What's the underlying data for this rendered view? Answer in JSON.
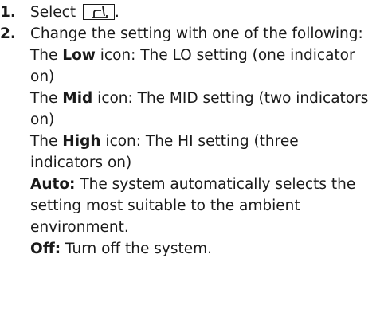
{
  "steps": [
    {
      "number": "1.",
      "text_before": "Select ",
      "icon": "seat-heater-icon",
      "text_after": "."
    },
    {
      "number": "2.",
      "intro": "Change the setting with one of the following:",
      "options": [
        {
          "prefix": "The ",
          "bold": "Low",
          "rest": " icon: The LO setting (one indicator on)"
        },
        {
          "prefix": "The ",
          "bold": "Mid",
          "rest": " icon: The MID setting (two indicators on)"
        },
        {
          "prefix": "The ",
          "bold": "High",
          "rest": " icon: The HI setting (three indicators on)"
        },
        {
          "prefix": "",
          "bold": "Auto:",
          "rest": " The system automatically selects the setting most suitable to the ambient environment."
        },
        {
          "prefix": "",
          "bold": "Off:",
          "rest": " Turn off the system."
        }
      ]
    }
  ]
}
